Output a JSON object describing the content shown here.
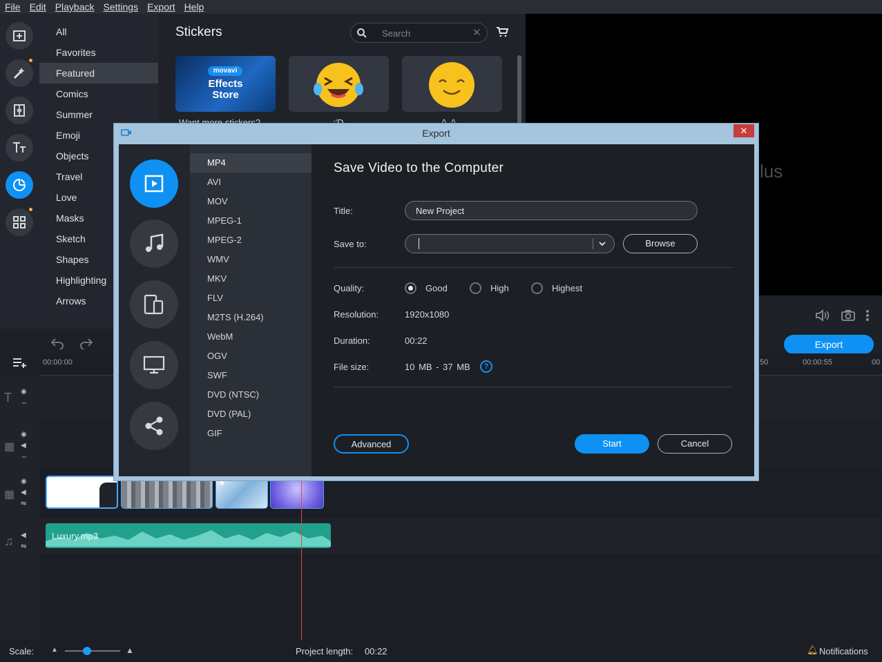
{
  "menu": [
    "File",
    "Edit",
    "Playback",
    "Settings",
    "Export",
    "Help"
  ],
  "categories": [
    "All",
    "Favorites",
    "Featured",
    "Comics",
    "Summer",
    "Emoji",
    "Objects",
    "Travel",
    "Love",
    "Masks",
    "Sketch",
    "Shapes",
    "Highlighting",
    "Arrows"
  ],
  "stickers": {
    "title": "Stickers",
    "search_placeholder": "Search",
    "store_brand": "movavi",
    "store_line1": "Effects",
    "store_line2": "Store",
    "captions": [
      "Want more stickers?",
      ":'D",
      "^_^"
    ]
  },
  "preview": {
    "partial_text": "lus"
  },
  "export_button": "Export",
  "ruler": {
    "start": "00:00:00",
    "mark1": "50",
    "mark2": "00:00:55",
    "mark3": "00"
  },
  "audio_clip": "Luxury.mp3",
  "bottom": {
    "scale_label": "Scale:",
    "scale_level": 0.4,
    "project_length_label": "Project length:",
    "project_length": "00:22",
    "notifications": "Notifications"
  },
  "dialog": {
    "title": "Export",
    "close": "✕",
    "formats": [
      "MP4",
      "AVI",
      "MOV",
      "MPEG-1",
      "MPEG-2",
      "WMV",
      "MKV",
      "FLV",
      "M2TS (H.264)",
      "WebM",
      "OGV",
      "SWF",
      "DVD (NTSC)",
      "DVD (PAL)",
      "GIF"
    ],
    "heading": "Save Video to the Computer",
    "title_label": "Title:",
    "title_value": "New Project",
    "save_to_label": "Save to:",
    "save_to_value": "",
    "browse": "Browse",
    "quality_label": "Quality:",
    "quality_options": [
      "Good",
      "High",
      "Highest"
    ],
    "quality_selected": "Good",
    "resolution_label": "Resolution:",
    "resolution": "1920x1080",
    "duration_label": "Duration:",
    "duration": "00:22",
    "file_size_label": "File size:",
    "file_size": "10 MB - 37 MB",
    "help": "?",
    "advanced": "Advanced",
    "start": "Start",
    "cancel": "Cancel"
  },
  "colors": {
    "accent": "#0e91f3",
    "audio": "#21a08e",
    "playhead": "#e0473c",
    "dialog_frame": "#a5c4de"
  }
}
